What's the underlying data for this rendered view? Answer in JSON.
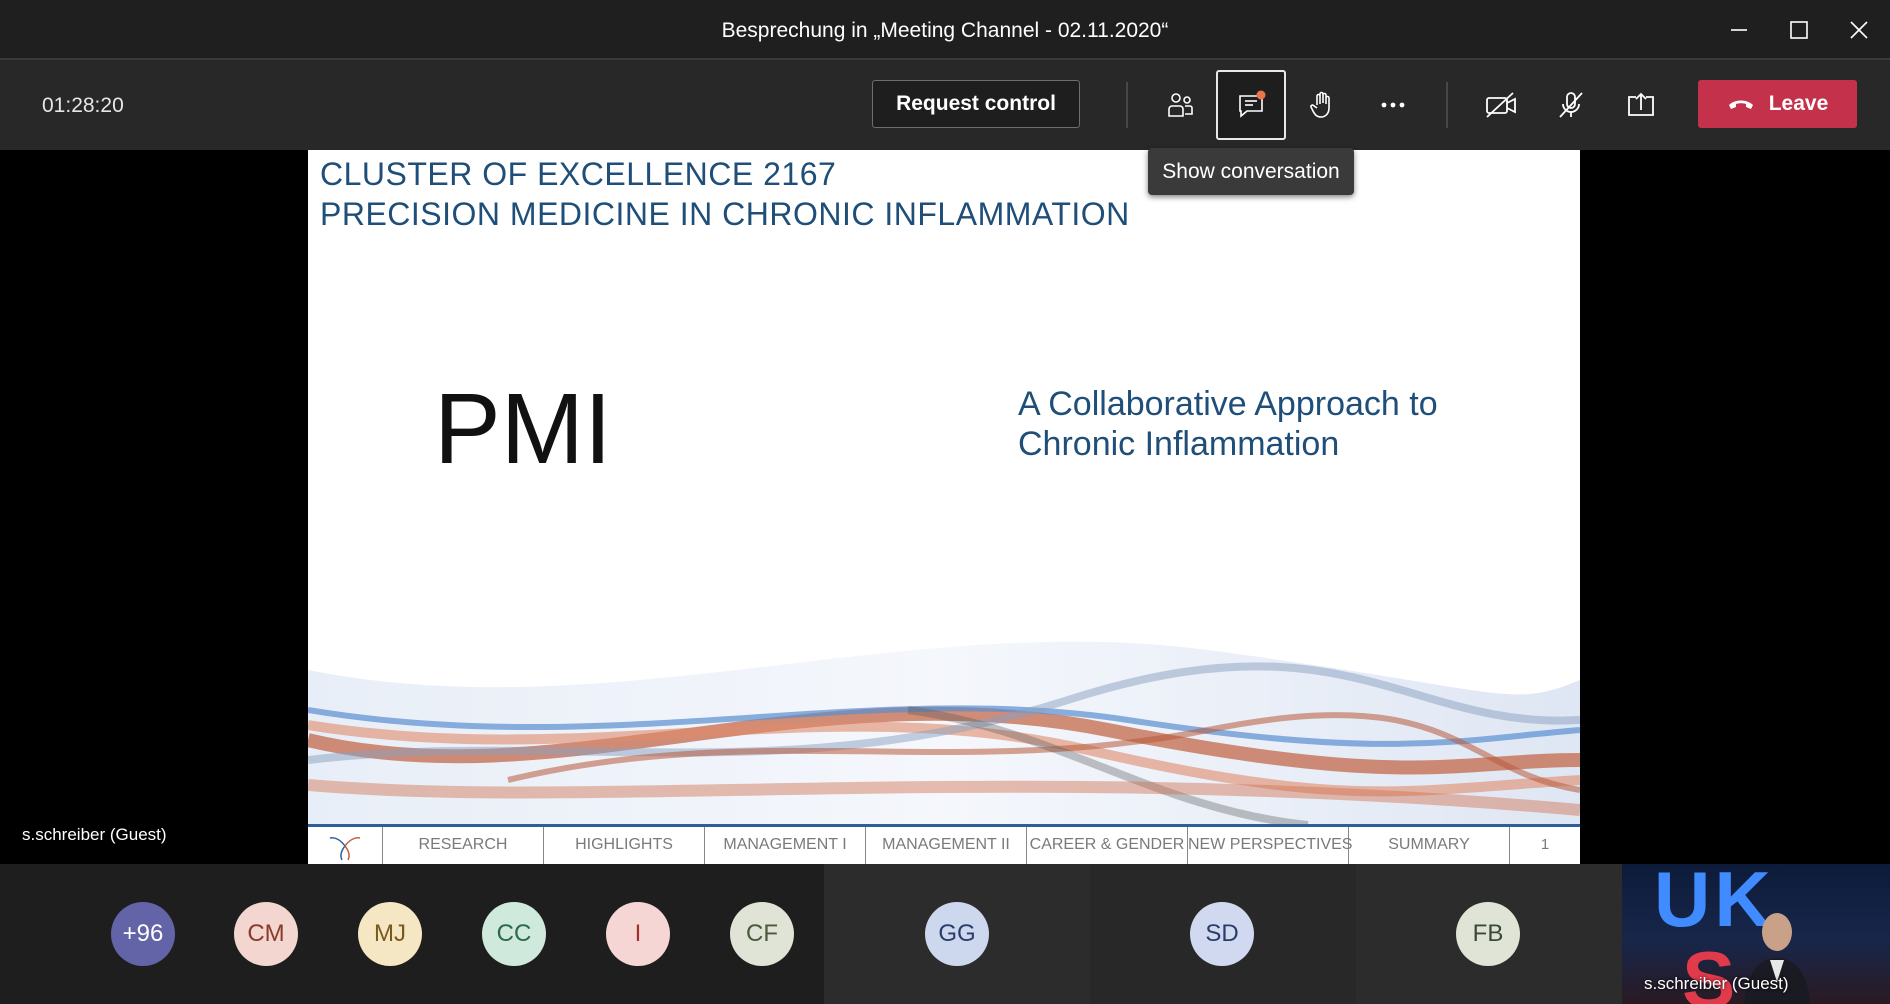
{
  "window": {
    "title": "Besprechung in „Meeting Channel - 02.11.2020“"
  },
  "toolbar": {
    "timer": "01:28:20",
    "request_control_label": "Request control",
    "leave_label": "Leave",
    "tooltip": "Show conversation",
    "leave_color": "#c4314b",
    "icons": [
      "participants-icon",
      "chat-icon",
      "raise-hand-icon",
      "more-icon",
      "camera-off-icon",
      "mic-off-icon",
      "share-icon",
      "phone-hangup-icon"
    ]
  },
  "slide": {
    "title_line1": "CLUSTER OF EXCELLENCE 2167",
    "title_line2": "PRECISION MEDICINE IN CHRONIC INFLAMMATION",
    "big_text": "PMI",
    "subtitle": "A Collaborative Approach to\nChronic Inflammation",
    "nav_items": [
      "RESEARCH",
      "HIGHLIGHTS",
      "MANAGEMENT I",
      "MANAGEMENT II",
      "CAREER & GENDER",
      "NEW PERSPECTIVES",
      "SUMMARY"
    ],
    "page_number": "1",
    "title_color": "#1f4e79"
  },
  "presenter_label": "s.schreiber (Guest)",
  "participants": [
    {
      "initials": "+96",
      "bg": "#6264a7",
      "fg": "#ffffff"
    },
    {
      "initials": "CM",
      "bg": "#f3d6d0",
      "fg": "#8a3a2a"
    },
    {
      "initials": "MJ",
      "bg": "#f5e6c4",
      "fg": "#7a5a1a"
    },
    {
      "initials": "CC",
      "bg": "#cfe9dc",
      "fg": "#2a6a4a"
    },
    {
      "initials": "I",
      "bg": "#f6d6d4",
      "fg": "#a3302a"
    },
    {
      "initials": "CF",
      "bg": "#dfe4d6",
      "fg": "#4a5a3a"
    }
  ],
  "tiles": [
    {
      "initials": "GG",
      "bg": "#cdd8ee",
      "fg": "#2a3d6a"
    },
    {
      "initials": "SD",
      "bg": "#d0d9f0",
      "fg": "#2a3d6a"
    },
    {
      "initials": "FB",
      "bg": "#dfe4d6",
      "fg": "#3a4a3a"
    }
  ],
  "video": {
    "name": "s.schreiber (Guest)",
    "backdrop_text_1": "UK",
    "backdrop_text_2": "S"
  }
}
